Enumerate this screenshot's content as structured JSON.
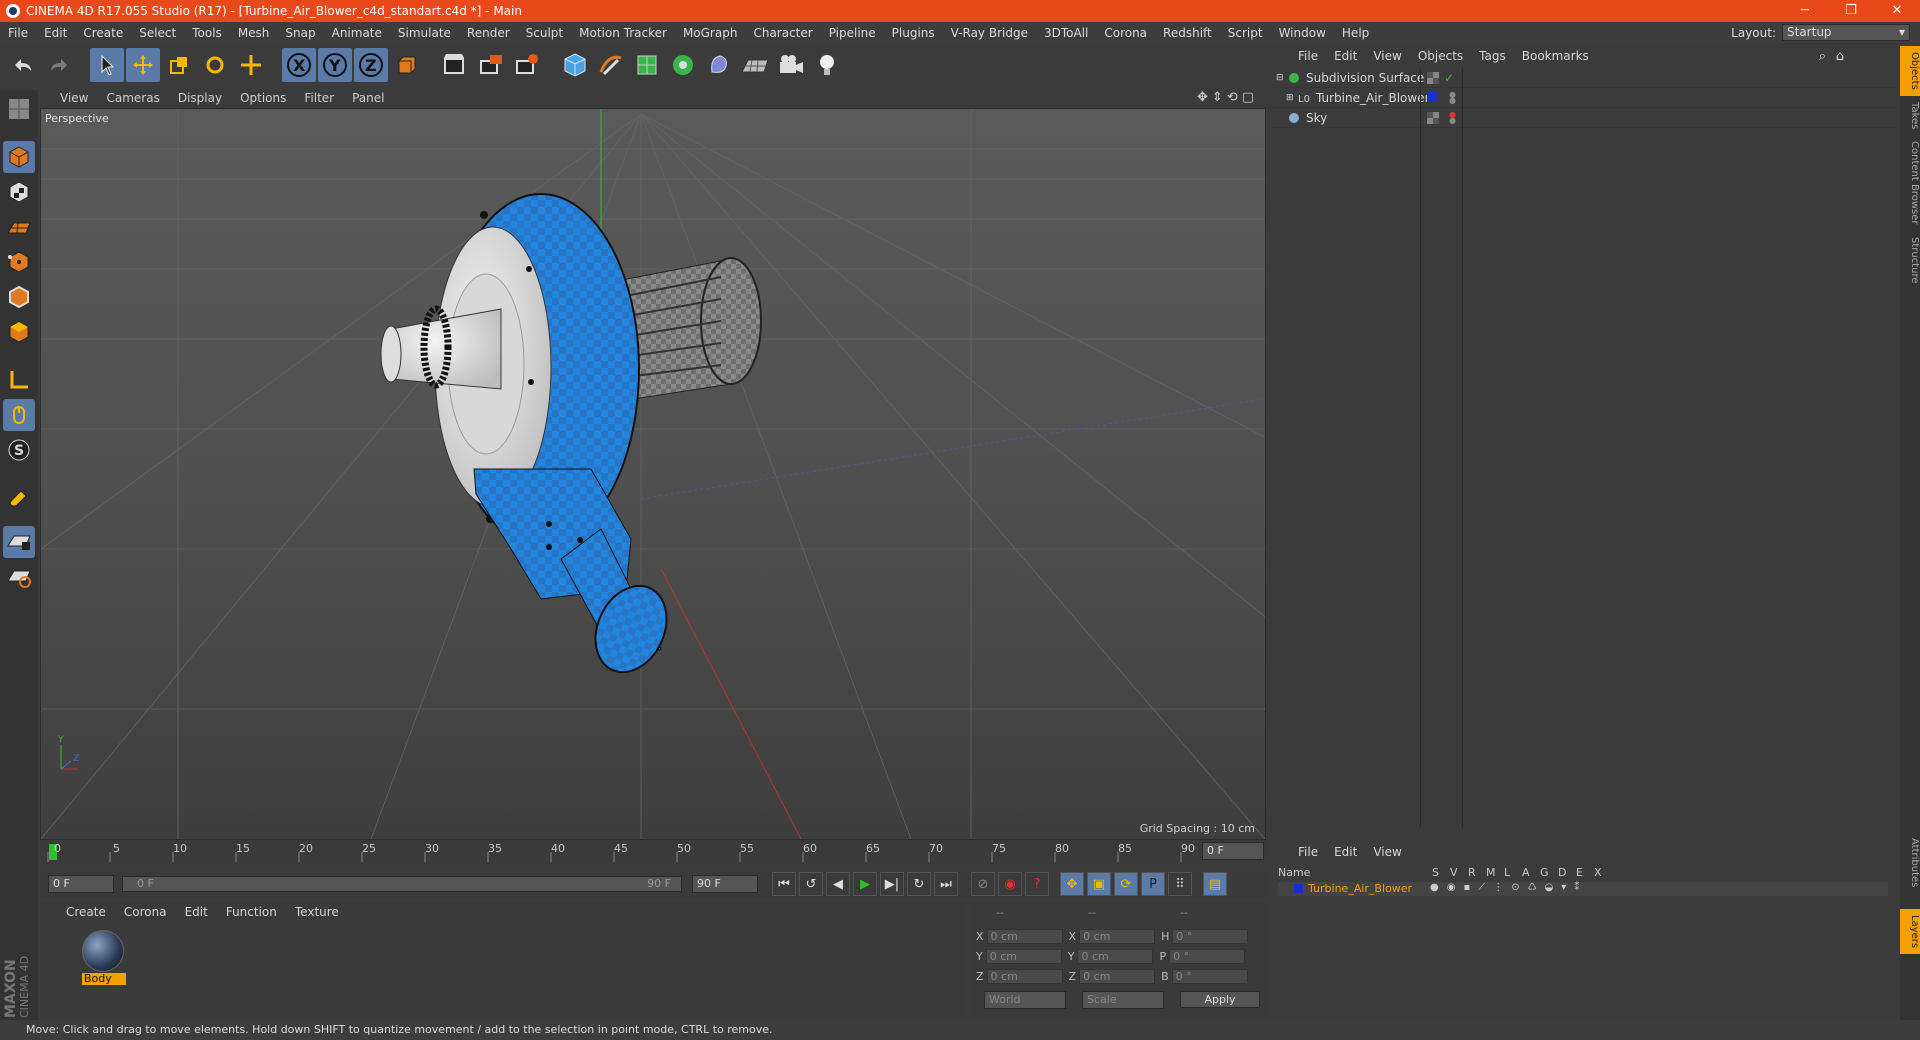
{
  "window": {
    "title": "CINEMA 4D R17.055 Studio (R17) - [Turbine_Air_Blower_c4d_standart.c4d *] - Main"
  },
  "menu": {
    "items": [
      "File",
      "Edit",
      "Create",
      "Select",
      "Tools",
      "Mesh",
      "Snap",
      "Animate",
      "Simulate",
      "Render",
      "Sculpt",
      "Motion Tracker",
      "MoGraph",
      "Character",
      "Pipeline",
      "Plugins",
      "V-Ray Bridge",
      "3DToAll",
      "Corona",
      "Redshift",
      "Script",
      "Window",
      "Help"
    ],
    "layout_label": "Layout:",
    "layout_value": "Startup"
  },
  "viewport": {
    "menu": [
      "View",
      "Cameras",
      "Display",
      "Options",
      "Filter",
      "Panel"
    ],
    "camera": "Perspective",
    "grid_spacing": "Grid Spacing : 10 cm"
  },
  "timeline": {
    "ticks": [
      "0",
      "5",
      "10",
      "15",
      "20",
      "25",
      "30",
      "35",
      "40",
      "45",
      "50",
      "55",
      "60",
      "65",
      "70",
      "75",
      "80",
      "85",
      "90"
    ],
    "frame_end_box": "0 F",
    "start": "0 F",
    "range_start": "0 F",
    "range_end": "90 F",
    "end": "90 F"
  },
  "materials": {
    "menu": [
      "Create",
      "Corona",
      "Edit",
      "Function",
      "Texture"
    ],
    "items": [
      {
        "name": "Body"
      }
    ]
  },
  "coords": {
    "headers": [
      "--",
      "--",
      "--"
    ],
    "rows": [
      {
        "a": "X",
        "av": "0 cm",
        "b": "X",
        "bv": "0 cm",
        "c": "H",
        "cv": "0 °"
      },
      {
        "a": "Y",
        "av": "0 cm",
        "b": "Y",
        "bv": "0 cm",
        "c": "P",
        "cv": "0 °"
      },
      {
        "a": "Z",
        "av": "0 cm",
        "b": "Z",
        "bv": "0 cm",
        "c": "B",
        "cv": "0 °"
      }
    ],
    "world": "World",
    "scale": "Scale",
    "apply": "Apply"
  },
  "objects": {
    "menu": [
      "File",
      "Edit",
      "View",
      "Objects",
      "Tags",
      "Bookmarks"
    ],
    "items": [
      {
        "name": "Subdivision Surface"
      },
      {
        "name": "Turbine_Air_Blower"
      },
      {
        "name": "Sky"
      }
    ]
  },
  "layers": {
    "menu": [
      "File",
      "Edit",
      "View"
    ],
    "columns": [
      "Name",
      "S",
      "V",
      "R",
      "M",
      "L",
      "A",
      "G",
      "D",
      "E",
      "X"
    ],
    "items": [
      {
        "name": "Turbine_Air_Blower"
      }
    ]
  },
  "side_tabs": [
    "Objects",
    "Takes",
    "Content Browser",
    "Structure"
  ],
  "side_tabs_bottom": [
    "Attributes",
    "Layers"
  ],
  "brand": {
    "line1": "MAXON",
    "line2": "CINEMA 4D"
  },
  "status": "Move: Click and drag to move elements. Hold down SHIFT to quantize movement / add to the selection in point mode, CTRL to remove.",
  "colors": {
    "titlebar": "#e8481a",
    "accent": "#5a7aa8",
    "blower_blue": "#1a7fd6",
    "material_tag": "#f3a000"
  }
}
